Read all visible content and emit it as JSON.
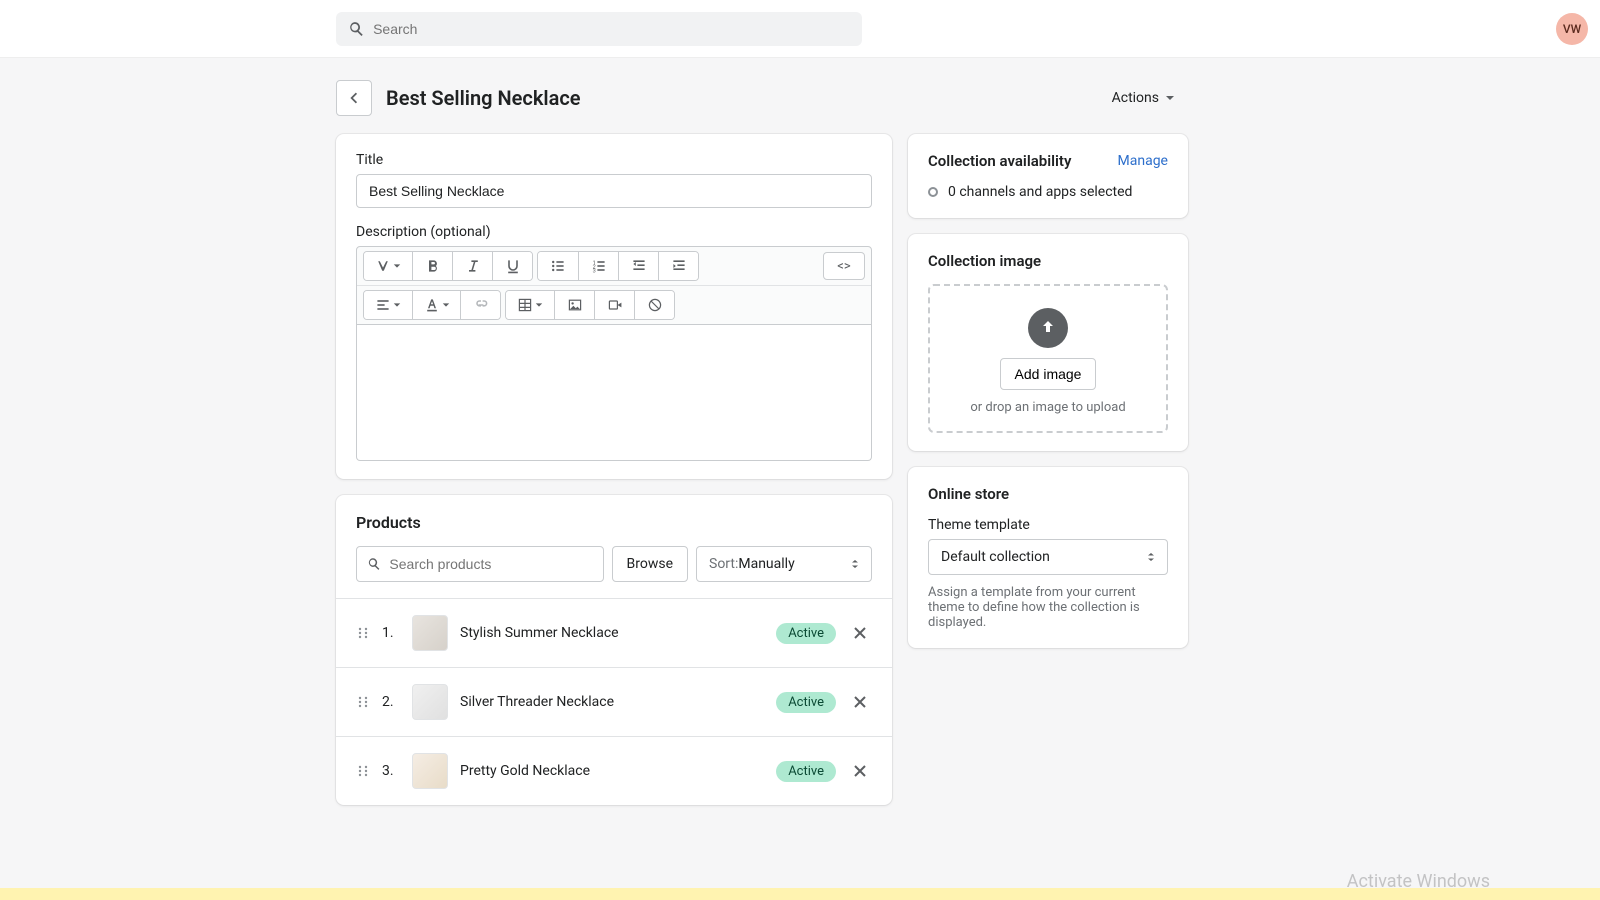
{
  "topbar": {
    "search_placeholder": "Search",
    "avatar_initials": "VW"
  },
  "header": {
    "title": "Best Selling Necklace",
    "actions_label": "Actions"
  },
  "main": {
    "title_label": "Title",
    "title_value": "Best Selling Necklace",
    "description_label": "Description (optional)",
    "code_toggle": "<>"
  },
  "products": {
    "heading": "Products",
    "search_placeholder": "Search products",
    "browse_label": "Browse",
    "sort_prefix": "Sort: ",
    "sort_value": "Manually",
    "items": [
      {
        "index": "1.",
        "name": "Stylish Summer Necklace",
        "status": "Active"
      },
      {
        "index": "2.",
        "name": "Silver Threader Necklace",
        "status": "Active"
      },
      {
        "index": "3.",
        "name": "Pretty Gold Necklace",
        "status": "Active"
      }
    ]
  },
  "availability": {
    "heading": "Collection availability",
    "manage": "Manage",
    "status": "0 channels and apps selected"
  },
  "image": {
    "heading": "Collection image",
    "button": "Add image",
    "hint": "or drop an image to upload"
  },
  "online_store": {
    "heading": "Online store",
    "theme_label": "Theme template",
    "theme_value": "Default collection",
    "help": "Assign a template from your current theme to define how the collection is displayed."
  },
  "watermark": "Activate Windows"
}
